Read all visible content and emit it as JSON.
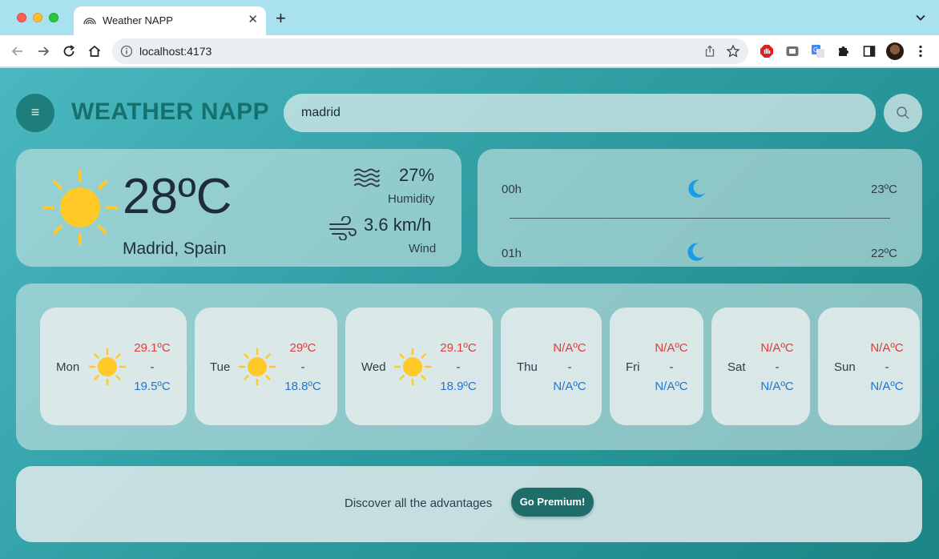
{
  "browser": {
    "tab_title": "Weather NAPP",
    "tab_close": "✕",
    "new_tab": "+",
    "url": "localhost:4173"
  },
  "app": {
    "title": "WEATHER NAPP",
    "menu_icon": "≡",
    "search": {
      "value": "madrid"
    }
  },
  "current": {
    "temperature": "28ºC",
    "location": "Madrid, Spain",
    "humidity_value": "27%",
    "humidity_label": "Humidity",
    "wind_value": "3.6 km/h",
    "wind_label": "Wind",
    "icon": "sun-icon"
  },
  "hourly": [
    {
      "time": "00h",
      "icon": "moon-icon",
      "temp": "23ºC"
    },
    {
      "time": "01h",
      "icon": "moon-icon",
      "temp": "22ºC"
    }
  ],
  "forecast": [
    {
      "day": "Mon",
      "icon": "sun-icon",
      "max": "29.1ºC",
      "sep": "-",
      "min": "19.5ºC"
    },
    {
      "day": "Tue",
      "icon": "sun-icon",
      "max": "29ºC",
      "sep": "-",
      "min": "18.8ºC"
    },
    {
      "day": "Wed",
      "icon": "sun-icon",
      "max": "29.1ºC",
      "sep": "-",
      "min": "18.9ºC"
    },
    {
      "day": "Thu",
      "icon": "",
      "max": "N/AºC",
      "sep": "-",
      "min": "N/AºC"
    },
    {
      "day": "Fri",
      "icon": "",
      "max": "N/AºC",
      "sep": "-",
      "min": "N/AºC"
    },
    {
      "day": "Sat",
      "icon": "",
      "max": "N/AºC",
      "sep": "-",
      "min": "N/AºC"
    },
    {
      "day": "Sun",
      "icon": "",
      "max": "N/AºC",
      "sep": "-",
      "min": "N/AºC"
    }
  ],
  "promo": {
    "text": "Discover all the advantages",
    "button": "Go Premium!"
  },
  "colors": {
    "accent": "#1d6e6b",
    "max_temp": "#e03a3a",
    "min_temp": "#1e74d6",
    "sun": "#ffc928",
    "moon": "#1a9be6"
  }
}
